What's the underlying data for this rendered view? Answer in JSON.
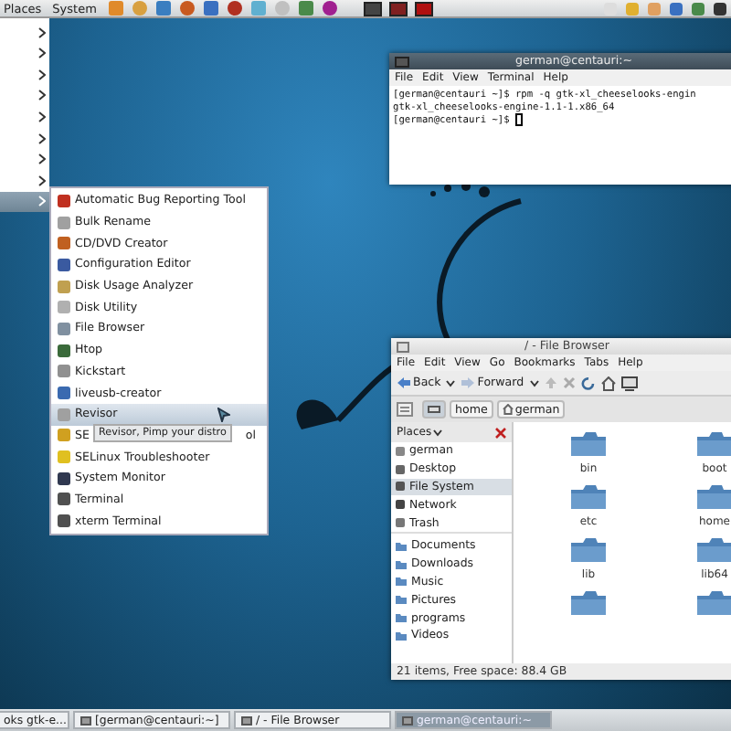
{
  "top_panel": {
    "menus": [
      "Places",
      "System"
    ]
  },
  "main_menu": {
    "items": [
      {
        "selected": false
      },
      {
        "selected": false
      },
      {
        "selected": false
      },
      {
        "selected": false
      },
      {
        "selected": false
      },
      {
        "selected": false
      },
      {
        "selected": false
      },
      {
        "selected": false
      },
      {
        "selected": true
      }
    ]
  },
  "submenu": {
    "items": [
      {
        "label": "Automatic Bug Reporting Tool",
        "selected": false
      },
      {
        "label": "Bulk Rename",
        "selected": false
      },
      {
        "label": "CD/DVD Creator",
        "selected": false
      },
      {
        "label": "Configuration Editor",
        "selected": false
      },
      {
        "label": "Disk Usage Analyzer",
        "selected": false
      },
      {
        "label": "Disk Utility",
        "selected": false
      },
      {
        "label": "File Browser",
        "selected": false
      },
      {
        "label": "Htop",
        "selected": false
      },
      {
        "label": "Kickstart",
        "selected": false
      },
      {
        "label": "liveusb-creator",
        "selected": false
      },
      {
        "label": "Revisor",
        "selected": true
      },
      {
        "label": "SE",
        "label_end": "ol",
        "selected": false
      },
      {
        "label": "SELinux Troubleshooter",
        "selected": false
      },
      {
        "label": "System Monitor",
        "selected": false
      },
      {
        "label": "Terminal",
        "selected": false
      },
      {
        "label": "xterm Terminal",
        "selected": false
      }
    ]
  },
  "tooltip": {
    "text": "Revisor, Pimp your distro"
  },
  "terminal": {
    "title": "german@centauri:~",
    "menu": [
      "File",
      "Edit",
      "View",
      "Terminal",
      "Help"
    ],
    "lines": [
      "[german@centauri ~]$ rpm -q gtk-xl_cheeselooks-engin",
      "gtk-xl_cheeselooks-engine-1.1-1.x86_64",
      "[german@centauri ~]$ "
    ]
  },
  "file_browser": {
    "title": "/ - File Browser",
    "menu": [
      "File",
      "Edit",
      "View",
      "Go",
      "Bookmarks",
      "Tabs",
      "Help"
    ],
    "toolbar": {
      "back": "Back",
      "forward": "Forward"
    },
    "path": [
      "home",
      "german"
    ],
    "sidebar": {
      "header": "Places",
      "places": [
        {
          "label": "german",
          "selected": false
        },
        {
          "label": "Desktop",
          "selected": false
        },
        {
          "label": "File System",
          "selected": true
        },
        {
          "label": "Network",
          "selected": false
        },
        {
          "label": "Trash",
          "selected": false
        }
      ],
      "bookmarks": [
        "Documents",
        "Downloads",
        "Music",
        "Pictures",
        "programs",
        "Videos"
      ]
    },
    "folders": [
      "bin",
      "boot",
      "etc",
      "home",
      "lib",
      "lib64"
    ],
    "status": "21 items, Free space: 88.4 GB"
  },
  "taskbar": {
    "items": [
      {
        "label": "oks gtk-e...",
        "selected": false
      },
      {
        "label": "[german@centauri:~]",
        "selected": false
      },
      {
        "label": "/ - File Browser",
        "selected": false
      },
      {
        "label": "german@centauri:~",
        "selected": true
      }
    ]
  }
}
